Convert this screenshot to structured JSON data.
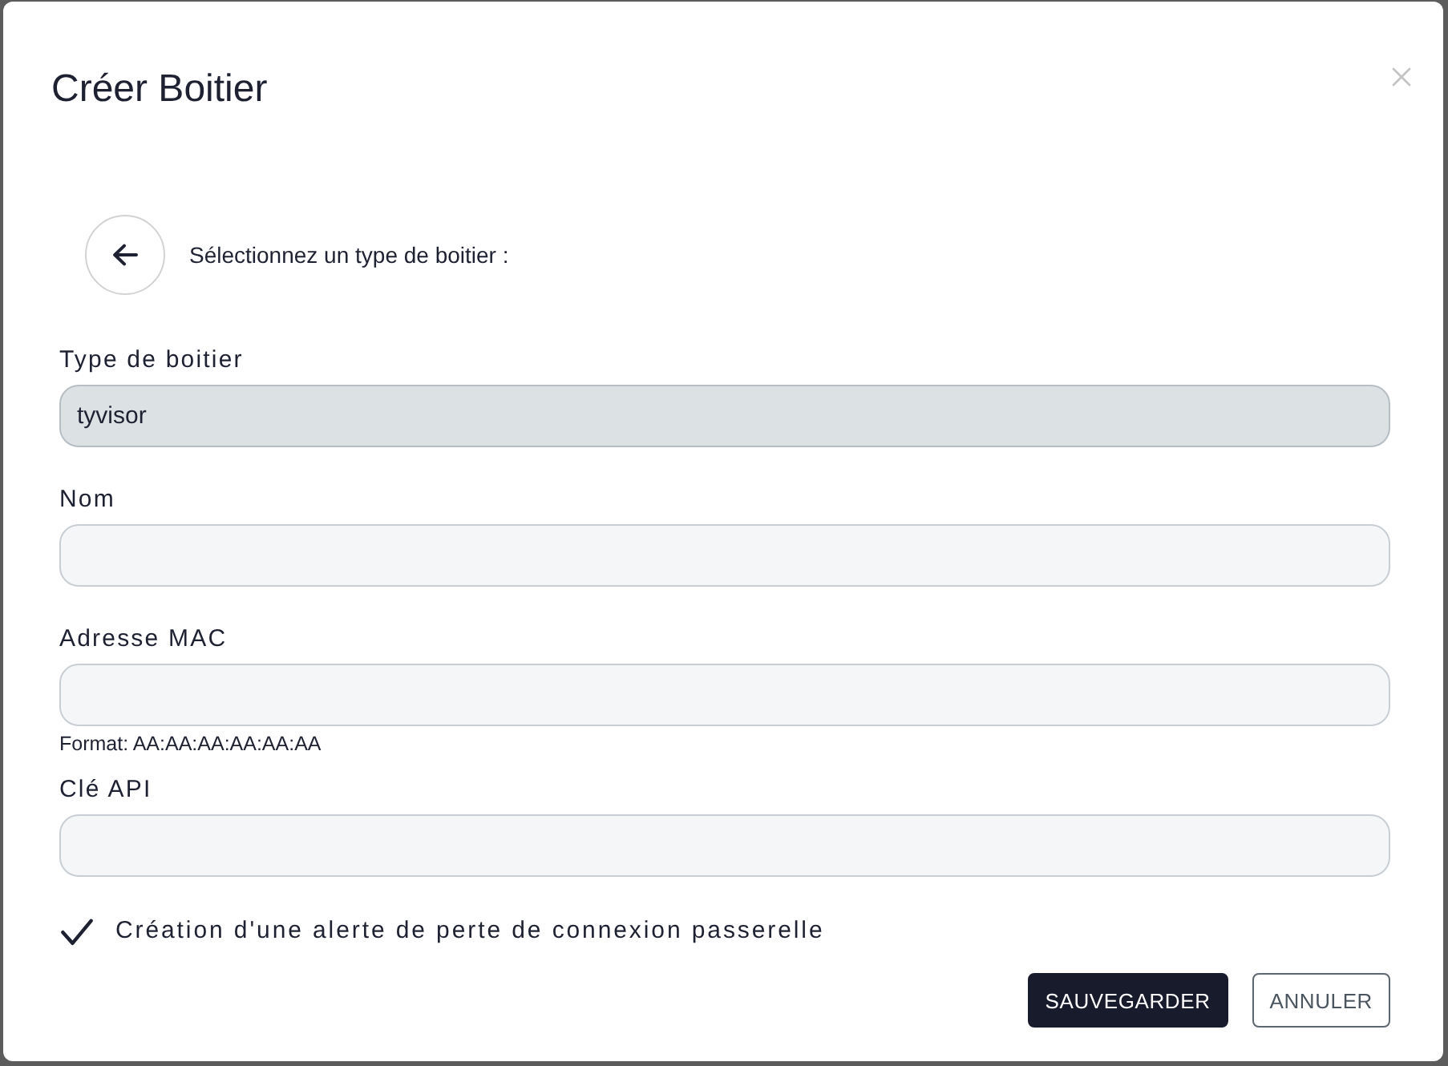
{
  "dialog": {
    "title": "Créer Boitier"
  },
  "prompt": "Sélectionnez un type de boitier :",
  "fields": [
    {
      "label": "Type de boitier",
      "value": "tyvisor",
      "disabled": true
    },
    {
      "label": "Nom",
      "disabled": false
    },
    {
      "label": "Adresse MAC",
      "disabled": false,
      "hint": "Format: AA:AA:AA:AA:AA:AA"
    },
    {
      "label": "Clé API",
      "disabled": false
    }
  ],
  "option": {
    "label": "Création d'une alerte de perte de connexion passerelle",
    "checked": true
  },
  "buttons": [
    {
      "label": "SAUVEGARDER",
      "kind": "primary"
    },
    {
      "label": "ANNULER",
      "kind": "secondary"
    }
  ]
}
